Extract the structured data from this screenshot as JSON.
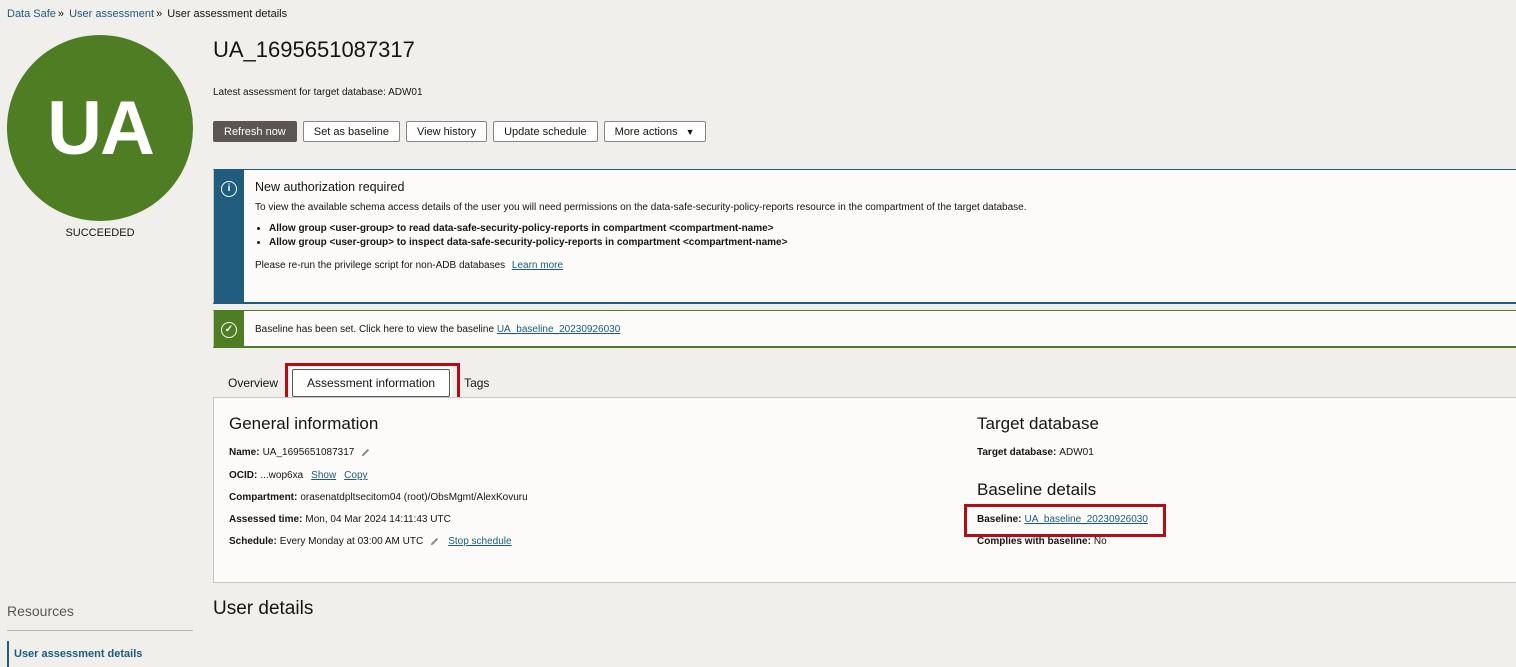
{
  "breadcrumb": {
    "items": [
      "Data Safe",
      "User assessment",
      "User assessment details"
    ],
    "separator": "»"
  },
  "avatar": {
    "initials": "UA",
    "status": "SUCCEEDED",
    "color": "#4f7d23"
  },
  "header": {
    "title": "UA_1695651087317",
    "subtitle": "Latest assessment for target database: ADW01"
  },
  "actions": {
    "refresh": "Refresh now",
    "set_baseline": "Set as baseline",
    "view_history": "View history",
    "update_schedule": "Update schedule",
    "more_actions": "More actions"
  },
  "info_notice": {
    "title": "New authorization required",
    "text": "To view the available schema access details of the user you will need permissions on the data-safe-security-policy-reports resource in the compartment of the target database.",
    "bullets": [
      "Allow group <user-group> to read data-safe-security-policy-reports in compartment <compartment-name>",
      "Allow group <user-group> to inspect data-safe-security-policy-reports in compartment <compartment-name>"
    ],
    "footer": "Please re-run the privilege script for non-ADB databases",
    "learn_more": "Learn more",
    "color": "#1f5c7e"
  },
  "success_notice": {
    "text": "Baseline has been set. Click here to view the baseline",
    "link": "UA_baseline_20230926030",
    "color": "#4f7d23"
  },
  "tabs": [
    {
      "label": "Overview"
    },
    {
      "label": "Assessment information",
      "active": true
    },
    {
      "label": "Tags"
    }
  ],
  "general": {
    "title": "General information",
    "name_key": "Name:",
    "name_val": "UA_1695651087317",
    "ocid_key": "OCID:",
    "ocid_val": "...wop6xa",
    "ocid_show": "Show",
    "ocid_copy": "Copy",
    "compartment_key": "Compartment:",
    "compartment_val": "orasenatdpltsecitom04 (root)/ObsMgmt/AlexKovuru",
    "assessed_key": "Assessed time:",
    "assessed_val": "Mon, 04 Mar 2024 14:11:43 UTC",
    "schedule_key": "Schedule:",
    "schedule_val": "Every Monday at 03:00 AM UTC",
    "stop_schedule": "Stop schedule"
  },
  "target": {
    "title": "Target database",
    "key": "Target database:",
    "val": "ADW01"
  },
  "baseline": {
    "title": "Baseline details",
    "key": "Baseline:",
    "val": "UA_baseline_20230926030",
    "complies_key": "Complies with baseline:",
    "complies_val": "No"
  },
  "user_details": {
    "title": "User details"
  },
  "resources": {
    "title": "Resources",
    "items": [
      "User assessment details"
    ]
  },
  "highlight_color": "#b50d15"
}
